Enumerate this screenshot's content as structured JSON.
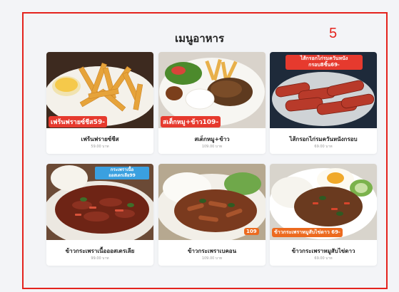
{
  "screen": {
    "title": "เมนูอาหาร",
    "annotation_number": "5",
    "accent_color": "#e4231d"
  },
  "menu_items": [
    {
      "name": "เฟร้นฟรายซ์ชีส",
      "price": "59.00 บาท",
      "photo_label": "เฟร้นฟรายซ์ชีส59-",
      "photo_label_color": "#e63a2e"
    },
    {
      "name": "สเต็กหมู+ข้าว",
      "price": "109.00 บาท",
      "photo_label": "สเต็กหมู+ข้าว109-",
      "photo_label_color": "#e63a2e"
    },
    {
      "name": "ไส้กรอกไก่รมควันหนังกรอบ",
      "price": "69.00 บาท",
      "photo_label": "ไส้กรอกไก่รมควันหนังกรอบ8ชิ้น69-",
      "photo_label_color": "#e63a2e"
    },
    {
      "name": "ข้าวกระเพราเนื้อออสเตรเลีย",
      "price": "99.00 บาท",
      "photo_label": "กระเพราเนื้อออสเตรเลีย99",
      "photo_label_color": "#3aa0e0"
    },
    {
      "name": "ข้าวกระเพราเบคอน",
      "price": "109.00 บาท",
      "photo_label": "109",
      "photo_label_color": "#ec6a1f"
    },
    {
      "name": "ข้าวกระเพราหมูสับไข่ดาว",
      "price": "69.00 บาท",
      "photo_label": "ข้าวกระเพราหมูสับไข่ดาว 69-",
      "photo_label_color": "#ec6a1f"
    }
  ]
}
